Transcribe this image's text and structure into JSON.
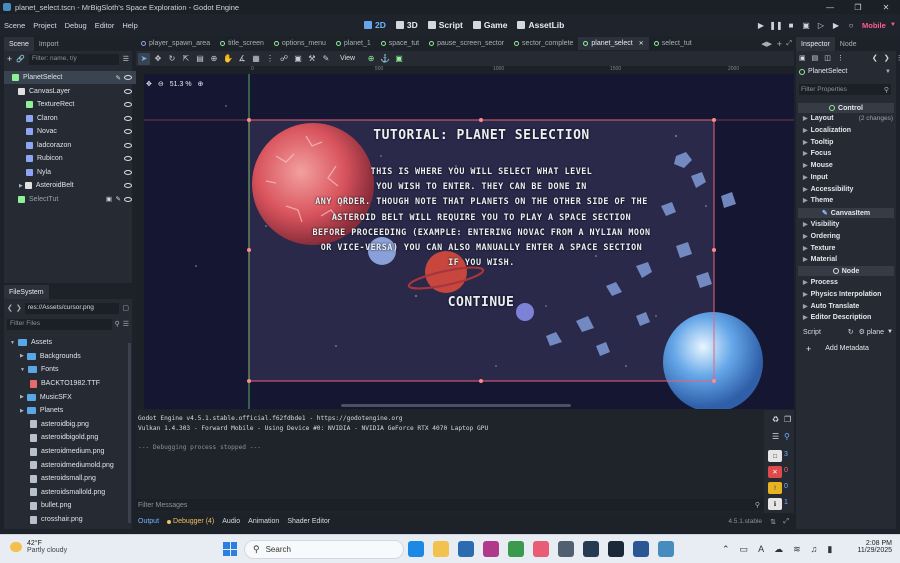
{
  "window": {
    "title": "planet_select.tscn - MrBigSloth's Space Exploration - Godot Engine"
  },
  "menu": [
    "Scene",
    "Project",
    "Debug",
    "Editor",
    "Help"
  ],
  "workspaces": [
    {
      "label": "2D",
      "active": true
    },
    {
      "label": "3D"
    },
    {
      "label": "Script"
    },
    {
      "label": "Game"
    },
    {
      "label": "AssetLib"
    }
  ],
  "renderer": "Mobile",
  "scene_dock": {
    "tabs": [
      "Scene",
      "Import"
    ],
    "filter_placeholder": "Filter: name, t/y",
    "nodes": [
      {
        "label": "PlanetSelect",
        "icon": "control-node-icon",
        "color": "#8eef97"
      },
      {
        "label": "CanvasLayer",
        "icon": "canvaslayer-icon",
        "color": "#e0e0e0"
      },
      {
        "label": "TextureRect",
        "icon": "texturerect-icon",
        "color": "#8eef97"
      },
      {
        "label": "Claron",
        "icon": "sprite-icon",
        "color": "#8da5f3"
      },
      {
        "label": "Novac",
        "icon": "sprite-icon",
        "color": "#8da5f3"
      },
      {
        "label": "ladcorazon",
        "icon": "sprite-icon",
        "color": "#8da5f3"
      },
      {
        "label": "Rubicon",
        "icon": "sprite-icon",
        "color": "#8da5f3"
      },
      {
        "label": "Nyla",
        "icon": "sprite-icon",
        "color": "#8da5f3"
      },
      {
        "label": "AsteroidBelt",
        "icon": "node2d-icon",
        "color": "#e0e0e0"
      },
      {
        "label": "SelectTut",
        "icon": "control-node-icon",
        "color": "#8eef97"
      }
    ]
  },
  "filesystem": {
    "title": "FileSystem",
    "path": "res://Assets/cursor.png",
    "filter_placeholder": "Filter Files",
    "items": [
      "Assets",
      "Backgrounds",
      "Fonts",
      "BACKTO1982.TTF",
      "MusicSFX",
      "Planets",
      "asteroidbig.png",
      "asteroidbigold.png",
      "asteroidmedium.png",
      "asteroidmediumold.png",
      "asteroidsmall.png",
      "asteroidsmallold.png",
      "bullet.png",
      "crosshair.png"
    ]
  },
  "scene_tabs": [
    "player_spawn_area",
    "title_screen",
    "options_menu",
    "planet_1",
    "space_tut",
    "pause_screen_sector",
    "sector_complete",
    "planet_select",
    "select_tut"
  ],
  "toolbar": {
    "view": "View"
  },
  "viewport": {
    "zoom": "51.3 %",
    "ruler_ticks": [
      "0",
      "500",
      "1000",
      "1500",
      "2000"
    ],
    "tutorial_title": "TUTORIAL: PLANET SELECTION",
    "tutorial_lines": [
      "THIS IS WHERE YOU WILL SELECT WHAT LEVEL",
      "YOU WISH TO ENTER. THEY CAN BE DONE IN",
      "ANY ORDER. THOUGH NOTE THAT PLANETS ON THE OTHER SIDE OF THE",
      "ASTEROID BELT WILL REQUIRE YOU TO PLAY A SPACE SECTION",
      "BEFORE PROCEEDING (EXAMPLE: ENTERING NOVAC FROM A NYLIAN MOON",
      "OR VICE-VERSA) YOU CAN ALSO MANUALLY ENTER A SPACE SECTION",
      "IF YOU WISH."
    ],
    "continue_label": "CONTINUE"
  },
  "output": {
    "lines": [
      "Godot Engine v4.5.1.stable.official.f62fdbde1 - https://godotengine.org",
      "Vulkan 1.4.303 - Forward Mobile - Using Device #0: NVIDIA - NVIDIA GeForce RTX 4070 Laptop GPU",
      "",
      "--- Debugging process stopped ---"
    ],
    "filter_placeholder": "Filter Messages",
    "counts": [
      "3",
      "0",
      "0",
      "1"
    ],
    "bottom_tabs": [
      "Output",
      "Debugger (4)",
      "Audio",
      "Animation",
      "Shader Editor"
    ],
    "version": "4.5.1.stable"
  },
  "inspector": {
    "tabs": [
      "Inspector",
      "Node"
    ],
    "node_name": "PlanetSelect",
    "filter_placeholder": "Filter Properties",
    "class_control": "Control",
    "groups": [
      {
        "label": "Layout",
        "note": "(2 changes)"
      },
      {
        "label": "Localization"
      },
      {
        "label": "Tooltip"
      },
      {
        "label": "Focus"
      },
      {
        "label": "Mouse"
      },
      {
        "label": "Input"
      },
      {
        "label": "Accessibility"
      },
      {
        "label": "Theme"
      }
    ],
    "class_canvasitem": "CanvasItem",
    "groups2": [
      "Visibility",
      "Ordering",
      "Texture",
      "Material"
    ],
    "class_node": "Node",
    "groups3": [
      "Process",
      "Physics Interpolation",
      "Auto Translate",
      "Editor Description"
    ],
    "script_label": "Script",
    "script_value": "plane",
    "add_metadata": "Add Metadata"
  },
  "taskbar": {
    "weather_temp": "42°F",
    "weather_desc": "Partly cloudy",
    "search": "Search",
    "time": "2:08 PM",
    "date": "11/29/2025"
  }
}
